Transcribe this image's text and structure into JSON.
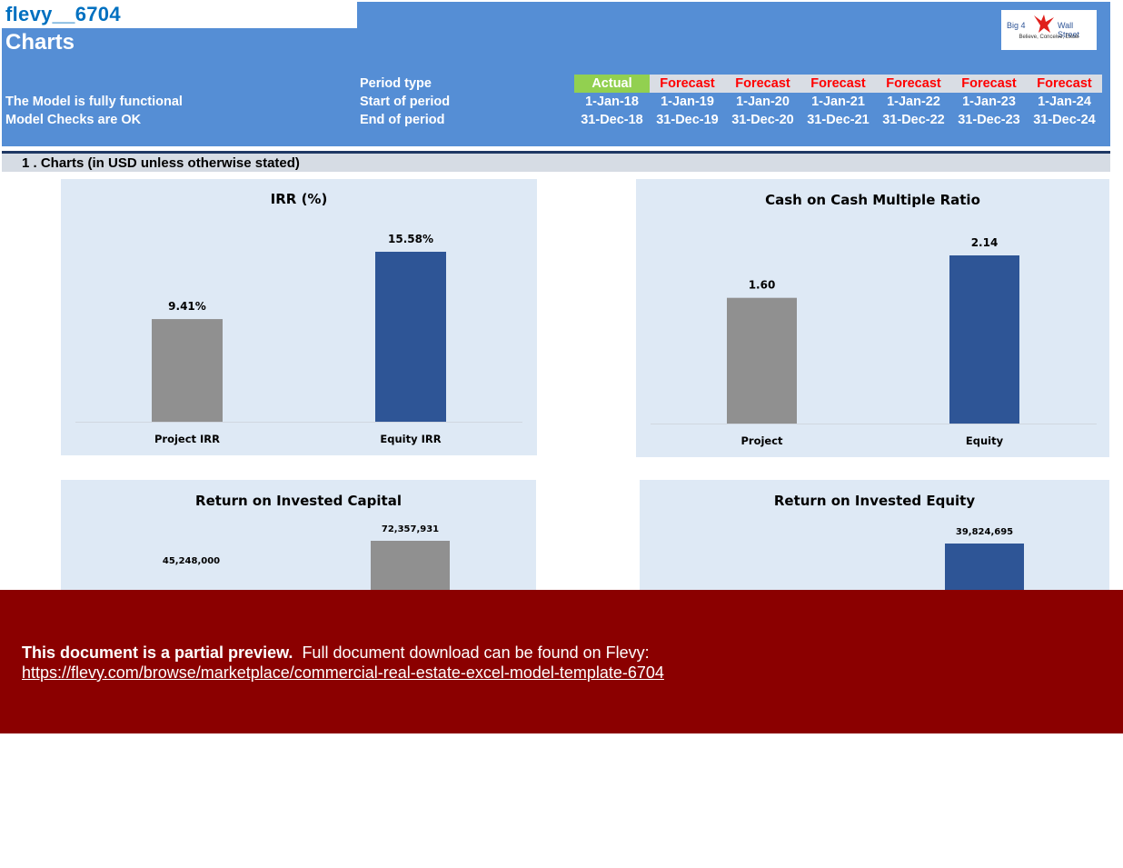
{
  "header": {
    "doc_id": "flevy__6704",
    "sheet_title": "Charts",
    "status_lines": [
      "The Model is fully functional",
      "Model Checks are OK"
    ],
    "logo": {
      "left": "Big 4",
      "right": "Wall Street",
      "tagline": "Believe, Conceive, Excel"
    },
    "period_labels": [
      "Period type",
      "Start of period",
      "End of period"
    ],
    "periods": [
      {
        "type": "Actual",
        "start": "1-Jan-18",
        "end": "31-Dec-18"
      },
      {
        "type": "Forecast",
        "start": "1-Jan-19",
        "end": "31-Dec-19"
      },
      {
        "type": "Forecast",
        "start": "1-Jan-20",
        "end": "31-Dec-20"
      },
      {
        "type": "Forecast",
        "start": "1-Jan-21",
        "end": "31-Dec-21"
      },
      {
        "type": "Forecast",
        "start": "1-Jan-22",
        "end": "31-Dec-22"
      },
      {
        "type": "Forecast",
        "start": "1-Jan-23",
        "end": "31-Dec-23"
      },
      {
        "type": "Forecast",
        "start": "1-Jan-24",
        "end": "31-Dec-24"
      }
    ]
  },
  "section": {
    "title": "1 .  Charts (in USD unless otherwise stated)"
  },
  "colors": {
    "header_blue": "#558ed5",
    "actual_green": "#92d050",
    "forecast_red": "#ff0000",
    "bar_gray": "#909090",
    "bar_blue": "#2e5596",
    "chart_bg": "#dee9f5",
    "banner_red": "#8b0000"
  },
  "chart_data": [
    {
      "type": "bar",
      "title": "IRR (%)",
      "categories": [
        "Project IRR",
        "Equity IRR"
      ],
      "values": [
        9.41,
        15.58
      ],
      "data_labels": [
        "9.41%",
        "15.58%"
      ],
      "bar_colors": [
        "#909090",
        "#2e5596"
      ],
      "xlabel": "",
      "ylabel": "",
      "ylim": [
        0,
        18
      ],
      "grid": false,
      "legend": "none"
    },
    {
      "type": "bar",
      "title": "Cash on Cash Multiple Ratio",
      "categories": [
        "Project",
        "Equity"
      ],
      "values": [
        1.6,
        2.14
      ],
      "data_labels": [
        "1.60",
        "2.14"
      ],
      "bar_colors": [
        "#909090",
        "#2e5596"
      ],
      "xlabel": "",
      "ylabel": "",
      "ylim": [
        0,
        2.4
      ],
      "grid": false,
      "legend": "none"
    },
    {
      "type": "bar",
      "title": "Return on Invested Capital",
      "categories": [
        "",
        ""
      ],
      "values": [
        45248000,
        72357931
      ],
      "data_labels": [
        "45,248,000",
        "72,357,931"
      ],
      "bar_colors": [
        "#2e5596",
        "#909090"
      ],
      "xlabel": "",
      "ylabel": "",
      "ylim": [
        0,
        85000000
      ],
      "grid": false,
      "legend": "none"
    },
    {
      "type": "bar",
      "title": "Return on Invested Equity",
      "categories": [
        "",
        ""
      ],
      "values": [
        null,
        39824695
      ],
      "data_labels": [
        "",
        "39,824,695"
      ],
      "bar_colors": [
        "#909090",
        "#2e5596"
      ],
      "xlabel": "",
      "ylabel": "",
      "ylim": [
        0,
        47000000
      ],
      "grid": false,
      "legend": "none"
    }
  ],
  "banner": {
    "lead": "This document is a partial preview.",
    "text": "Full document download can be found on Flevy:",
    "link": "https://flevy.com/browse/marketplace/commercial-real-estate-excel-model-template-6704"
  }
}
